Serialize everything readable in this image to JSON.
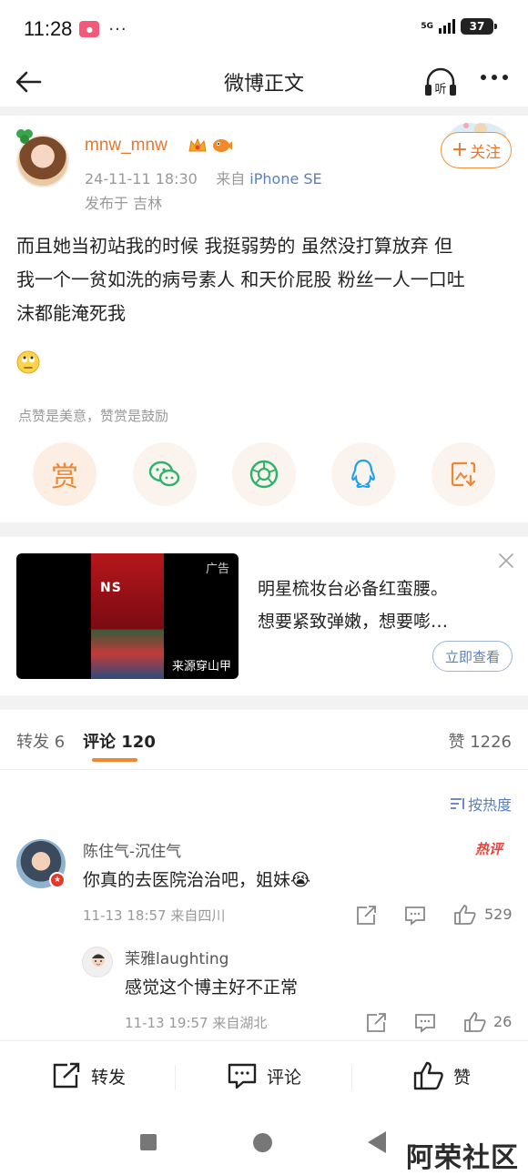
{
  "status_bar": {
    "time": "11:28",
    "app_badge_icon": "xiaohongshu-icon",
    "more_indicator": "···",
    "network": "5G",
    "battery": "37"
  },
  "nav": {
    "title": "微博正文",
    "back_icon": "back-arrow-icon",
    "listen_icon": "headphones-icon",
    "listen_label": "听",
    "more_icon": "more-icon"
  },
  "post": {
    "author": "mnw_mnw",
    "timestamp": "24-11-11 18:30",
    "from_prefix": "来自",
    "device": "iPhone SE",
    "location": "发布于 吉林",
    "follow_label": "关注",
    "follow_plus": "+",
    "body_lines": [
      "而且她当初站我的时候 我挺弱势的 虽然没打算放弃 但",
      "我一个一贫如洗的病号素人 和天价屁股 粉丝一人一口吐",
      "沫都能淹死我"
    ],
    "emoji_icon": "rolling-eyes-emoji-icon",
    "reward_hint": "点赞是美意，赞赏是鼓励",
    "reward_button": "赏",
    "share_icons": [
      "wechat-icon",
      "moments-icon",
      "qq-icon",
      "save-image-icon"
    ]
  },
  "ad": {
    "tag": "广告",
    "source": "来源穿山甲",
    "product_text": "NS",
    "title": "明星梳妆台必备红蛮腰。",
    "subtitle": "想要紧致弹嫩，想要嘭…",
    "cta": "立即查看",
    "close_icon": "close-icon"
  },
  "tabs": {
    "repost": "转发 6",
    "comment": "评论 120",
    "likes": "赞 1226",
    "sort": "按热度"
  },
  "comments": [
    {
      "name": "陈住气-沉住气",
      "badge": "热评",
      "text": "你真的去医院治治吧，姐妹😭",
      "meta": "11-13 18:57  来自四川",
      "likes": "529"
    },
    {
      "name": "茉雅laughting",
      "text": "感觉这个博主好不正常",
      "meta": "11-13 19:57  来自湖北",
      "likes": "26"
    }
  ],
  "bottom_bar": {
    "repost": "转发",
    "comment": "评论",
    "like": "赞"
  },
  "watermark": "阿荣社区",
  "colors": {
    "accent_orange": "#f0862f",
    "link_blue": "#5b7fb6",
    "hot_red": "#e8433a"
  }
}
